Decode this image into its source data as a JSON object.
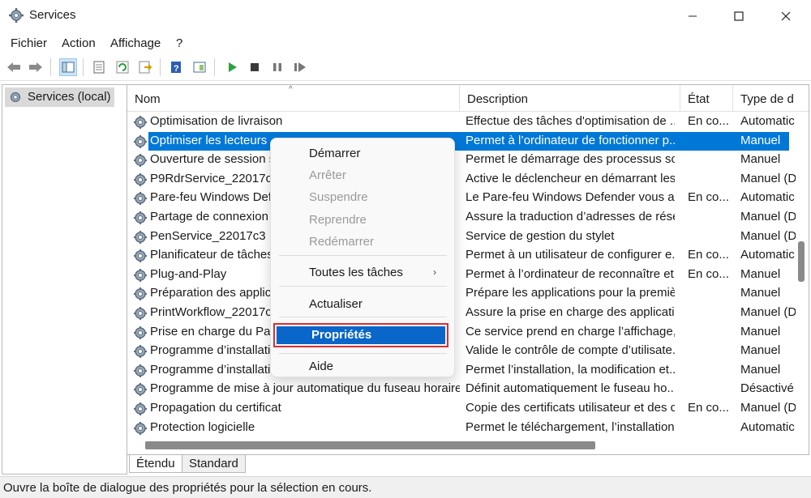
{
  "window": {
    "title": "Services"
  },
  "menubar": {
    "items": [
      "Fichier",
      "Action",
      "Affichage",
      "?"
    ]
  },
  "tree": {
    "item": "Services (local)"
  },
  "list": {
    "columns": [
      "Nom",
      "Description",
      "État",
      "Type de d"
    ],
    "rows": [
      {
        "name": "Optimisation de livraison",
        "desc": "Effectue des tâches d'optimisation de ...",
        "state": "En co...",
        "type": "Automatic"
      },
      {
        "name": "Optimiser les lecteurs",
        "desc": "Permet à l’ordinateur de fonctionner p...",
        "state": "",
        "type": "Manuel"
      },
      {
        "name": "Ouverture de session s",
        "desc": "Permet le démarrage des processus so...",
        "state": "",
        "type": "Manuel"
      },
      {
        "name": "P9RdrService_22017c3",
        "desc": "Active le déclencheur en démarrant les...",
        "state": "",
        "type": "Manuel (D"
      },
      {
        "name": "Pare-feu Windows Defe",
        "desc": "Le Pare-feu Windows Defender vous ai...",
        "state": "En co...",
        "type": "Automatic"
      },
      {
        "name": "Partage de connexion I",
        "desc": "Assure la traduction d’adresses de rése...",
        "state": "",
        "type": "Manuel (D"
      },
      {
        "name": "PenService_22017c3",
        "desc": "Service de gestion du stylet",
        "state": "",
        "type": "Manuel (D"
      },
      {
        "name": "Planificateur de tâches",
        "desc": "Permet à un utilisateur de configurer e...",
        "state": "En co...",
        "type": "Automatic"
      },
      {
        "name": "Plug-and-Play",
        "desc": "Permet à l’ordinateur de reconnaître et...",
        "state": "En co...",
        "type": "Manuel"
      },
      {
        "name": "Préparation des applica",
        "desc": "Prépare les applications pour la premiè...",
        "state": "",
        "type": "Manuel"
      },
      {
        "name": "PrintWorkflow_22017c3",
        "desc": "Assure la prise en charge des applicati...",
        "state": "",
        "type": "Manuel (D"
      },
      {
        "name": "Prise en charge du Pan",
        "desc": "Ce service prend en charge l’affichage, ...",
        "state": "",
        "type": "Manuel"
      },
      {
        "name": "Programme d’installatio",
        "desc": "Valide le contrôle de compte d’utilisate...",
        "state": "",
        "type": "Manuel"
      },
      {
        "name": "Programme d’installatio",
        "desc": "Permet l’installation, la modification et...",
        "state": "",
        "type": "Manuel"
      },
      {
        "name": "Programme de mise à jour automatique du fuseau horaire",
        "desc": "Définit automatiquement le fuseau ho...",
        "state": "",
        "type": "Désactivé"
      },
      {
        "name": "Propagation du certificat",
        "desc": "Copie des certificats utilisateur et des c...",
        "state": "En co...",
        "type": "Manuel (D"
      },
      {
        "name": "Protection logicielle",
        "desc": "Permet le téléchargement, l’installation...",
        "state": "",
        "type": "Automatic"
      }
    ]
  },
  "context_menu": {
    "start": "Démarrer",
    "stop": "Arrêter",
    "pause": "Suspendre",
    "resume": "Reprendre",
    "restart": "Redémarrer",
    "all_tasks": "Toutes les tâches",
    "refresh": "Actualiser",
    "properties": "Propriétés",
    "help": "Aide"
  },
  "tabs": {
    "extended": "Étendu",
    "standard": "Standard"
  },
  "status": {
    "text": "Ouvre la boîte de dialogue des propriétés pour la sélection en cours."
  },
  "colors": {
    "selection": "#0078d7",
    "highlight_border": "#d63030"
  }
}
